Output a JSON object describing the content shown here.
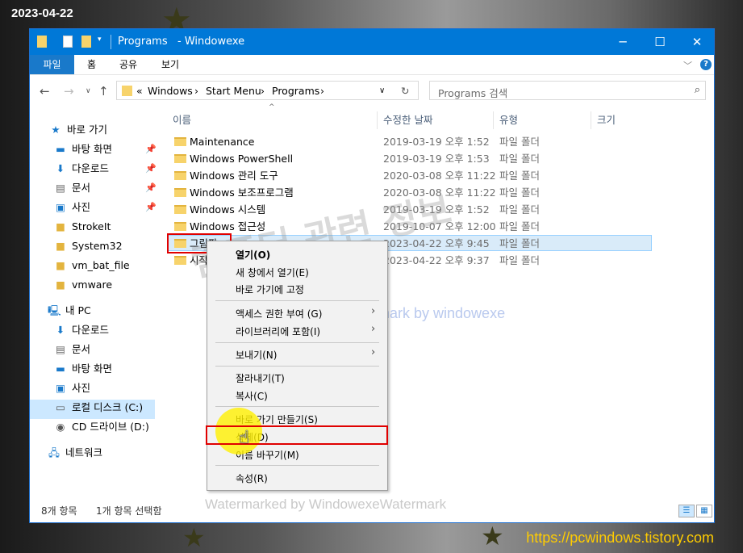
{
  "overlay": {
    "date": "2023-04-22",
    "blog_url": "https://pcwindows.tistory.com",
    "watermark_bottom": "Watermarked by WindowexeWatermark",
    "watermark_center": "watermark by windowexe",
    "watermark_korean": "컴퓨터 관련 정보",
    "url_color": "#ffcc00"
  },
  "window": {
    "title": "Programs   - Windowexe",
    "controls": {
      "minimize": "─",
      "maximize": "☐",
      "close": "✕"
    },
    "ribbon_tabs": [
      "파일",
      "홈",
      "공유",
      "보기"
    ],
    "help_icon": "?",
    "accent": "#0078d7"
  },
  "address": {
    "prefix": "«",
    "crumbs": [
      "Windows",
      "Start Menu",
      "Programs"
    ],
    "search_placeholder": "Programs 검색"
  },
  "nav": {
    "quick_access": "바로 가기",
    "quick_items": [
      "바탕 화면",
      "다운로드",
      "문서",
      "사진",
      "StrokeIt",
      "System32",
      "vm_bat_file",
      "vmware"
    ],
    "this_pc": "내 PC",
    "pc_items": [
      "다운로드",
      "문서",
      "바탕 화면",
      "사진",
      "로컬 디스크 (C:)",
      "CD 드라이브 (D:)"
    ],
    "network": "네트워크"
  },
  "columns": [
    "이름",
    "수정한 날짜",
    "유형",
    "크기"
  ],
  "files": [
    {
      "name": "Maintenance",
      "date": "2019-03-19 오후 1:52",
      "type": "파일 폴더"
    },
    {
      "name": "Windows PowerShell",
      "date": "2019-03-19 오후 1:53",
      "type": "파일 폴더"
    },
    {
      "name": "Windows 관리 도구",
      "date": "2020-03-08 오후 11:22",
      "type": "파일 폴더"
    },
    {
      "name": "Windows 보조프로그램",
      "date": "2020-03-08 오후 11:22",
      "type": "파일 폴더"
    },
    {
      "name": "Windows 시스템",
      "date": "2019-03-19 오후 1:52",
      "type": "파일 폴더"
    },
    {
      "name": "Windows 접근성",
      "date": "2019-10-07 오후 12:00",
      "type": "파일 폴더"
    },
    {
      "name": "그림판",
      "date": "2023-04-22 오후 9:45",
      "type": "파일 폴더"
    },
    {
      "name": "시작",
      "date": "2023-04-22 오후 9:37",
      "type": "파일 폴더"
    }
  ],
  "status": {
    "count": "8개 항목",
    "selected": "1개 항목 선택함"
  },
  "context_menu": {
    "open": "열기(O)",
    "open_new": "새 창에서 열기(E)",
    "pin": "바로 가기에 고정",
    "access": "액세스 권한 부여 (G)",
    "library": "라이브러리에 포함(I)",
    "send_to": "보내기(N)",
    "cut": "잘라내기(T)",
    "copy": "복사(C)",
    "shortcut": "바로 가기 만들기(S)",
    "delete": "삭제(D)",
    "rename": "이름 바꾸기(M)",
    "properties": "속성(R)"
  }
}
